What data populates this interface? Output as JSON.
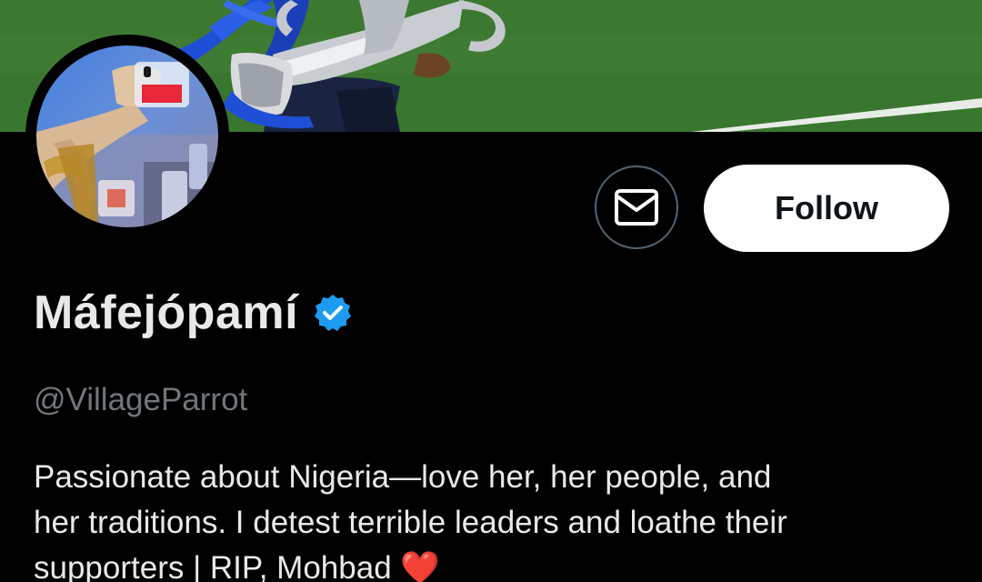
{
  "profile": {
    "display_name": "Máfejópamí",
    "handle": "@VillageParrot",
    "verified": true,
    "bio_lines": [
      "Passionate about Nigeria—love her, her people, and",
      "her traditions. I detest terrible leaders and loathe their",
      "supporters | RIP, Mohbad ❤️"
    ]
  },
  "actions": {
    "message_icon": "mail-icon",
    "follow_label": "Follow"
  },
  "colors": {
    "background": "#000000",
    "primary_text": "#e7e9ea",
    "secondary_text": "#71767b",
    "verified_badge": "#1d9bf0",
    "follow_button_bg": "#ffffff",
    "icon_button_border": "#536471"
  }
}
